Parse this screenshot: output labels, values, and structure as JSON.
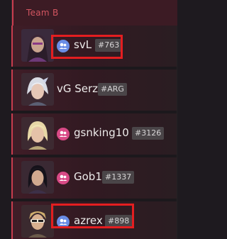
{
  "team": {
    "title": "Team B"
  },
  "players": [
    {
      "name": "svL",
      "tag": "#763",
      "platform": "blue",
      "highlighted": true
    },
    {
      "name": "vG Serz",
      "tag": "#ARG",
      "platform": "none",
      "highlighted": false
    },
    {
      "name": "gsnking10",
      "tag": "#3126",
      "platform": "pink",
      "highlighted": false
    },
    {
      "name": "Gob1",
      "tag": "#1337",
      "platform": "pink",
      "highlighted": false
    },
    {
      "name": "azrex",
      "tag": "#898",
      "platform": "blue",
      "highlighted": true
    }
  ],
  "colors": {
    "accent": "#c83c4e",
    "platform_blue": "#6a8de6",
    "platform_pink": "#d94a86",
    "highlight": "#e41e20"
  }
}
